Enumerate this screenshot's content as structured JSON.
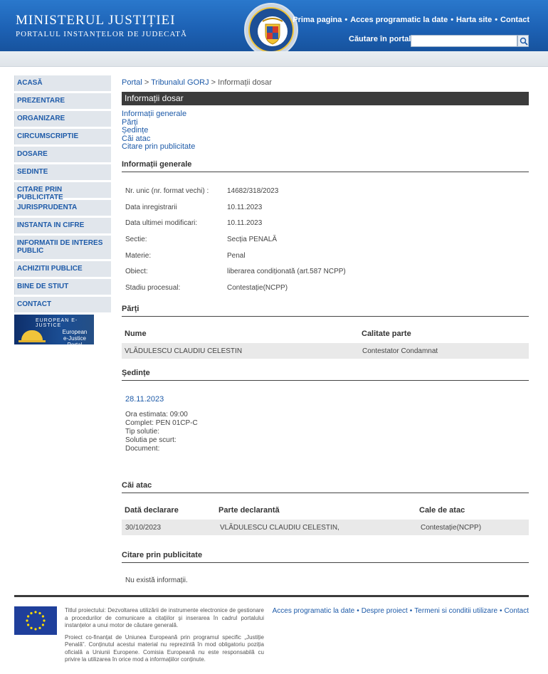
{
  "header": {
    "title": "MINISTERUL JUSTIȚIEI",
    "subtitle": "PORTALUL INSTANȚELOR DE JUDECATĂ",
    "crest_text_top": "ROMANIA",
    "crest_text_bottom": "MINISTERUL JUSTIȚIEI",
    "nav": [
      "Prima pagina",
      "Acces programatic la date",
      "Harta site",
      "Contact"
    ],
    "search_label": "Căutare în portal",
    "search_value": ""
  },
  "sidebar": {
    "items": [
      "ACASĂ",
      "PREZENTARE",
      "ORGANIZARE",
      "CIRCUMSCRIPTIE",
      "DOSARE",
      "SEDINTE",
      "CITARE PRIN PUBLICITATE",
      "JURISPRUDENTA",
      "INSTANTA IN CIFRE",
      "INFORMATII DE INTERES PUBLIC",
      "ACHIZITII PUBLICE",
      "BINE DE STIUT",
      "CONTACT"
    ],
    "banner_small": "EUROPEAN E-JUSTICE",
    "banner_line1": "European",
    "banner_line2": "e-Justice Portal"
  },
  "breadcrumb": {
    "portal": "Portal",
    "court": "Tribunalul GORJ",
    "current": "Informații dosar"
  },
  "page_title": "Informații dosar",
  "anchors": [
    "Informații generale",
    "Părți",
    "Ședințe",
    "Căi atac",
    "Citare prin publicitate"
  ],
  "general": {
    "title": "Informații generale",
    "rows": [
      {
        "label": "Nr. unic (nr. format vechi) :",
        "value": "14682/318/2023"
      },
      {
        "label": "Data inregistrarii",
        "value": "10.11.2023"
      },
      {
        "label": "Data ultimei modificari:",
        "value": "10.11.2023"
      },
      {
        "label": "Sectie:",
        "value": "Secția PENALĂ"
      },
      {
        "label": "Materie:",
        "value": "Penal"
      },
      {
        "label": "Obiect:",
        "value": "liberarea condiționată (art.587 NCPP)"
      },
      {
        "label": "Stadiu procesual:",
        "value": "Contestație(NCPP)"
      }
    ]
  },
  "parti": {
    "title": "Părți",
    "headers": [
      "Nume",
      "Calitate parte"
    ],
    "rows": [
      [
        "VLĂDULESCU CLAUDIU CELESTIN",
        "Contestator Condamnat"
      ]
    ]
  },
  "sedinte": {
    "title": "Ședințe",
    "date": "28.11.2023",
    "lines": [
      "Ora estimata: 09:00",
      "Complet: PEN 01CP-C",
      "Tip solutie:",
      "Solutia pe scurt:",
      "Document:"
    ]
  },
  "cai_atac": {
    "title": "Căi atac",
    "headers": [
      "Dată declarare",
      "Parte declarantă",
      "Cale de atac"
    ],
    "rows": [
      [
        "30/10/2023",
        "VLĂDULESCU CLAUDIU CELESTIN,",
        "Contestație(NCPP)"
      ]
    ]
  },
  "citare": {
    "title": "Citare prin publicitate",
    "empty": "Nu există informații."
  },
  "footer": {
    "p1": "Titlul proiectului: Dezvoltarea utilizării de instrumente electronice de gestionare a procedurilor de comunicare a citațiilor și inserarea în cadrul portalului instanțelor a unui motor de căutare generală.",
    "p2": "Proiect co-finanțat de Uniunea Europeană prin programul specific „Justiție Penală”. Conținutul acestui material nu reprezintă în mod obligatoriu poziția oficială a Uniunii Europene. Comisia Europeană nu este responsabilă cu privire la utilizarea în orice mod a informațiilor conținute.",
    "links": [
      "Acces programatic la date",
      "Despre proiect",
      "Termeni si conditii utilizare",
      "Contact"
    ]
  },
  "colors": {
    "header_blue": "#1d62b5",
    "link_blue": "#1d5aa8",
    "dark_bar": "#3b3b3b",
    "sidebar_bg": "#e1e6ec",
    "row_bg": "#e9e9e9"
  }
}
